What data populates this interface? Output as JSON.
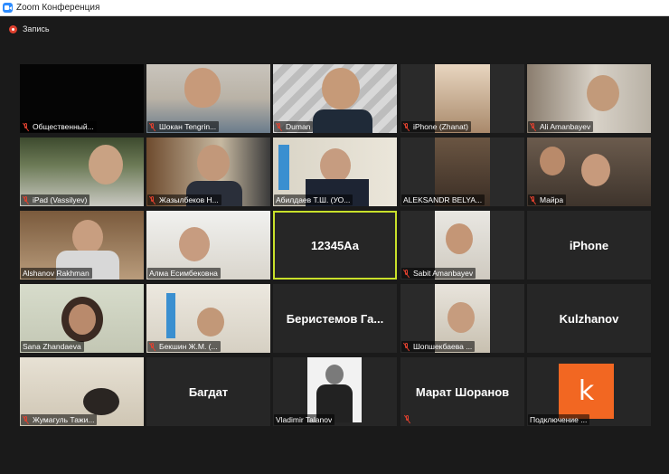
{
  "window": {
    "title": "Zoom Конференция"
  },
  "recording": {
    "label": "Запись"
  },
  "tiles": [
    {
      "name": "Общественный...",
      "muted": true
    },
    {
      "name": "Шокан Tengrin...",
      "muted": true
    },
    {
      "name": "Duman",
      "muted": true
    },
    {
      "name": "iPhone (Zhanat)",
      "muted": true
    },
    {
      "name": "Ali Amanbayev",
      "muted": true
    },
    {
      "name": "iPad (Vassilyev)",
      "muted": true
    },
    {
      "name": "Жазылбеков Н...",
      "muted": true
    },
    {
      "name": "Абилдаев Т.Ш. (УО...",
      "muted": false
    },
    {
      "name": "ALEKSANDR BELYA...",
      "muted": false
    },
    {
      "name": "Майра",
      "muted": true
    },
    {
      "name": "Alshanov Rakhman",
      "muted": false
    },
    {
      "name": "Алма Есимбековна",
      "muted": false
    },
    {
      "name": "12345Аа",
      "muted": false,
      "text_only": true
    },
    {
      "name": "Sabit Amanbayev",
      "muted": true
    },
    {
      "name": "iPhone",
      "muted": false,
      "text_only": true
    },
    {
      "name": "Sana Zhandaeva",
      "muted": false
    },
    {
      "name": "Бекшин Ж.М. (...",
      "muted": true
    },
    {
      "name": "Беристемов Га...",
      "muted": false,
      "text_only": true
    },
    {
      "name": "Шопшекбаева ...",
      "muted": true
    },
    {
      "name": "Kulzhanov",
      "muted": false,
      "text_only": true
    },
    {
      "name": "Жумагуль Тажи...",
      "muted": true
    },
    {
      "name": "Багдат",
      "muted": false,
      "text_only": true
    },
    {
      "name": "Vladimir Talanov",
      "muted": false
    },
    {
      "name": "Марат Шоранов",
      "muted": true,
      "text_only": true
    },
    {
      "name": "Подключение ...",
      "muted": false,
      "logo": "k"
    }
  ],
  "colors": {
    "background": "#1a1a1a",
    "active_speaker": "#c8e02a",
    "muted_red": "#e0412f",
    "zoom_blue": "#2d8cff"
  }
}
